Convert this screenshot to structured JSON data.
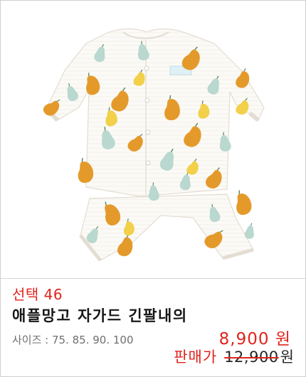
{
  "product": {
    "image_alt": "애플망고 자가드 긴팔내의",
    "pick_label": "선택 46",
    "name": "애플망고 자가드 긴팔내의",
    "size_text": "사이즈 : 75. 85. 90. 100",
    "sale_price": "8,900 원",
    "regular_label": "판매가",
    "regular_price": "12,900",
    "regular_currency": "원"
  },
  "colors": {
    "accent_red": "#e0231c",
    "text_dark": "#161616",
    "text_gray": "#6f6f6f",
    "border": "#cfcfcf",
    "mango_orange": "#e49a2b",
    "mango_yellow": "#f2d04a",
    "pear_mint": "#b9d8cf"
  }
}
